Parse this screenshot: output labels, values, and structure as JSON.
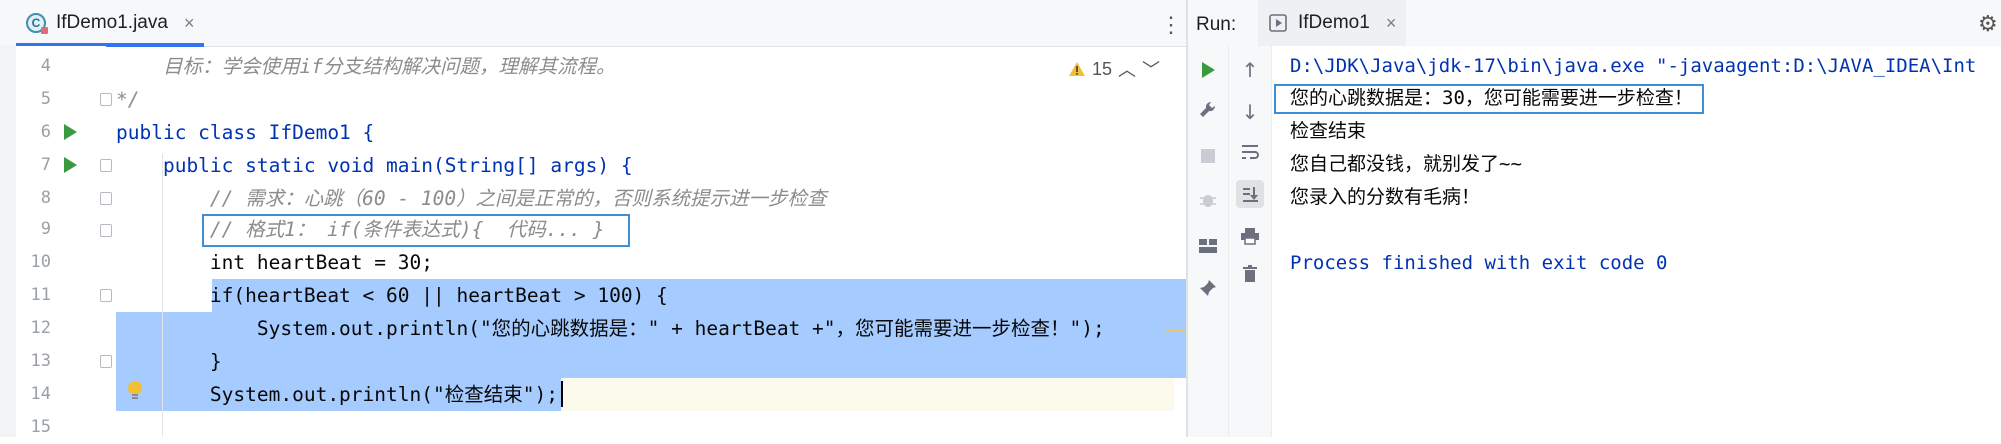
{
  "editor": {
    "tab": {
      "title": "IfDemo1.java",
      "icon": "java-class-icon",
      "close": "×"
    },
    "menu": "⋮",
    "warnings": {
      "count": "15",
      "up": "︿",
      "down": "﹀"
    },
    "lines": [
      {
        "n": "4",
        "text": "    目标：学会使用if分支结构解决问题，理解其流程。"
      },
      {
        "n": "5",
        "text": "*/"
      },
      {
        "n": "6",
        "text": "public class IfDemo1 {"
      },
      {
        "n": "7",
        "text": "    public static void main(String[] args) {"
      },
      {
        "n": "8",
        "text": "        // 需求：心跳（60 - 100）之间是正常的，否则系统提示进一步检查"
      },
      {
        "n": "9",
        "text": "        // 格式1： if(条件表达式){  代码... }"
      },
      {
        "n": "10",
        "text": "        int heartBeat = 30;"
      },
      {
        "n": "11",
        "text": "        if(heartBeat < 60 || heartBeat > 100) {"
      },
      {
        "n": "12",
        "text": "            System.out.println(\"您的心跳数据是：\" + heartBeat +\"，您可能需要进一步检查！\");"
      },
      {
        "n": "13",
        "text": "        }"
      },
      {
        "n": "14",
        "text": "        System.out.println(\"检查结束\");"
      },
      {
        "n": "15",
        "text": ""
      }
    ]
  },
  "run": {
    "label": "Run:",
    "tab": {
      "title": "IfDemo1",
      "close": "×"
    },
    "console": [
      "D:\\JDK\\Java\\jdk-17\\bin\\java.exe \"-javaagent:D:\\JAVA_IDEA\\Int",
      "您的心跳数据是：30，您可能需要进一步检查！",
      "检查结束",
      "您自己都没钱，就别发了~~",
      "您录入的分数有毛病！",
      "",
      "Process finished with exit code 0"
    ]
  },
  "colors": {
    "selection": "#a6cbfe",
    "accent": "#3574f0",
    "keyword": "#0033b3",
    "string": "#067d17",
    "number": "#1750eb",
    "comment": "#8c8c8c",
    "console_path": "#0033b3",
    "console_text": "#080808"
  }
}
